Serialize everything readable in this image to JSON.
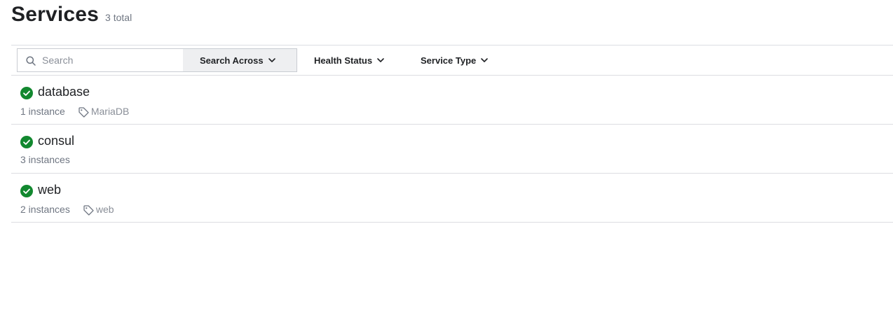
{
  "header": {
    "title": "Services",
    "count": "3 total"
  },
  "filters": {
    "search_placeholder": "Search",
    "search_value": "",
    "search_across_label": "Search Across",
    "health_status_label": "Health Status",
    "service_type_label": "Service Type"
  },
  "colors": {
    "healthy": "#12882f",
    "border": "#dcdde2",
    "muted_text": "#6f7682"
  },
  "services": [
    {
      "name": "database",
      "instances": "1 instance",
      "tag": "MariaDB",
      "status_icon": "check-circle-icon"
    },
    {
      "name": "consul",
      "instances": "3 instances",
      "tag": "",
      "status_icon": "check-circle-icon"
    },
    {
      "name": "web",
      "instances": "2 instances",
      "tag": "web",
      "status_icon": "check-circle-icon"
    }
  ]
}
